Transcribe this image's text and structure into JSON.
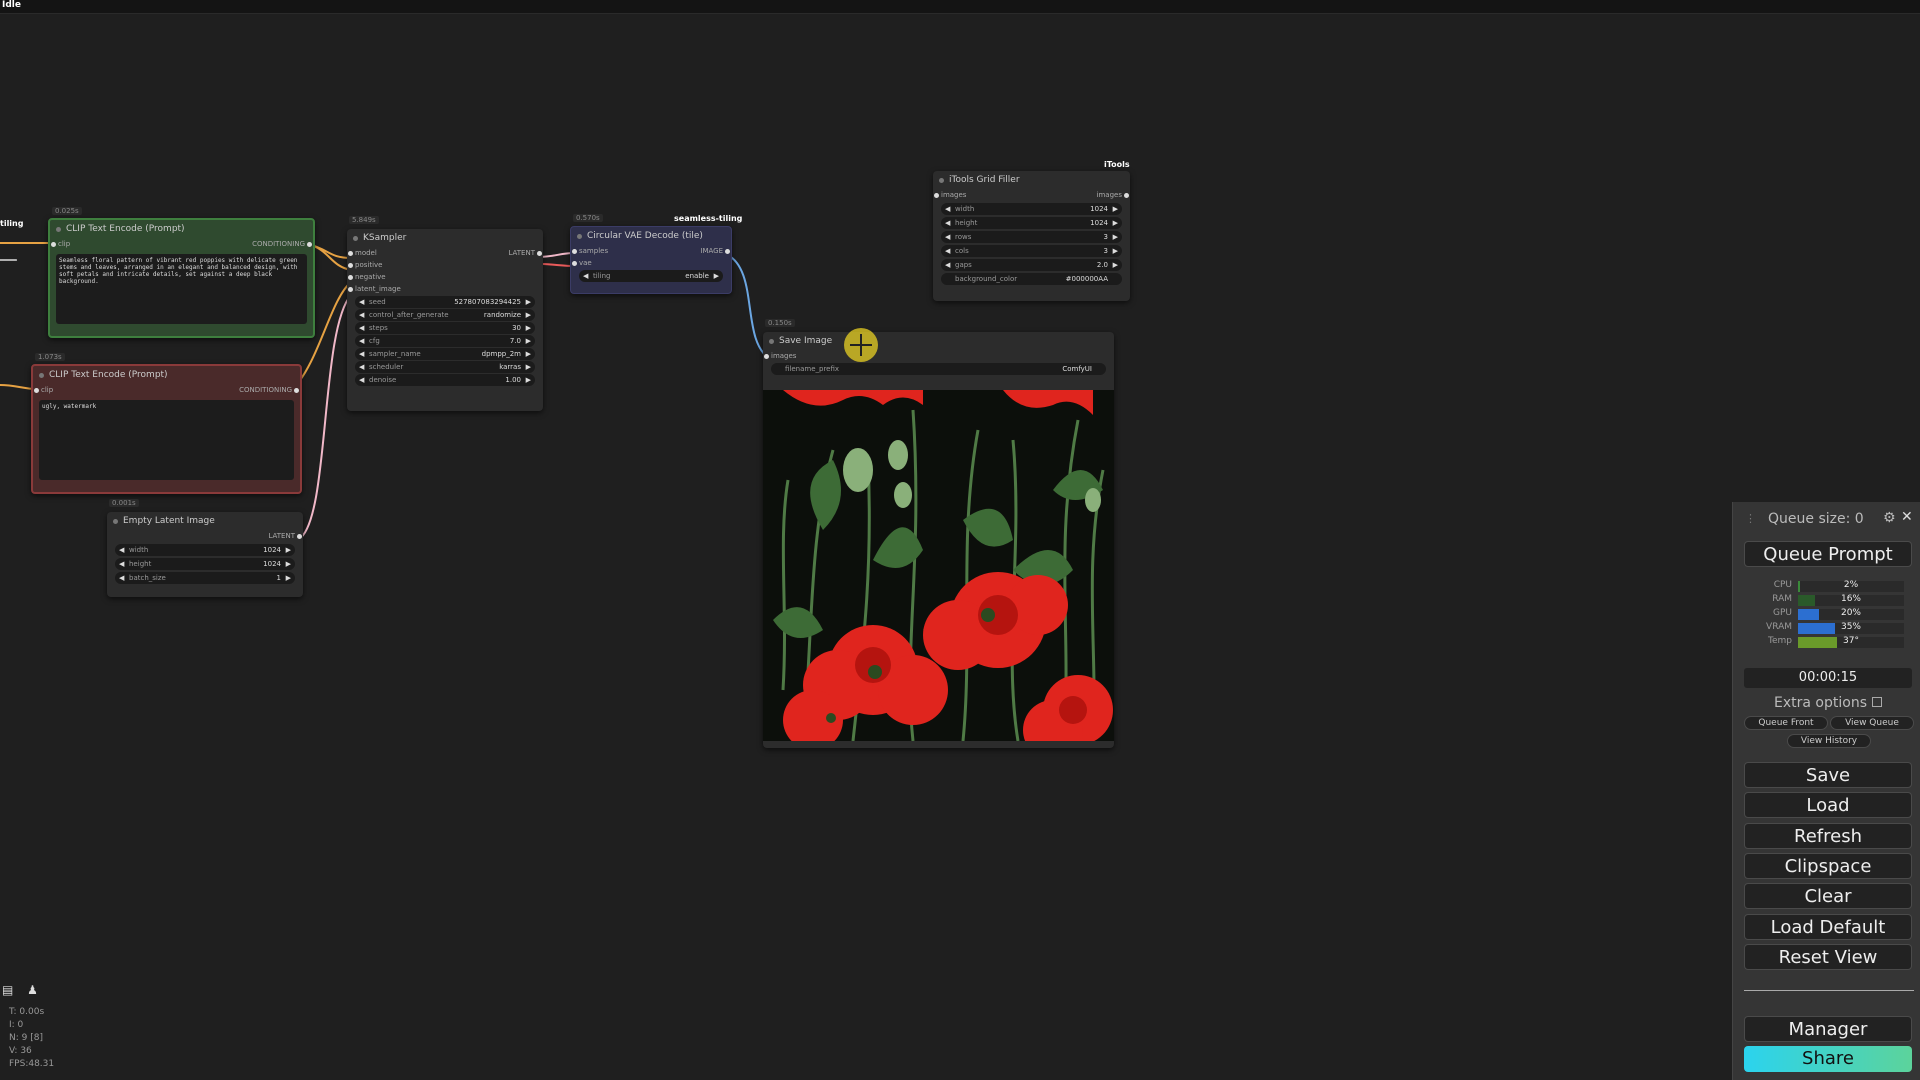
{
  "status": "Idle",
  "tags": {
    "itools": "iTools",
    "seamless": "seamless-tiling",
    "left_edge": "tiling"
  },
  "nodes": {
    "clip_pos": {
      "time": "0.025s",
      "title": "CLIP Text Encode (Prompt)",
      "input": "clip",
      "output": "CONDITIONING",
      "text": "Seamless floral pattern of vibrant red poppies with delicate green stems and leaves, arranged in an elegant and balanced design, with soft petals and intricate details, set against a deep black background."
    },
    "clip_neg": {
      "time": "1.073s",
      "title": "CLIP Text Encode (Prompt)",
      "input": "clip",
      "output": "CONDITIONING",
      "text": "ugly, watermark"
    },
    "empty_latent": {
      "time": "0.001s",
      "title": "Empty Latent Image",
      "output": "LATENT",
      "widgets": [
        {
          "label": "width",
          "value": "1024"
        },
        {
          "label": "height",
          "value": "1024"
        },
        {
          "label": "batch_size",
          "value": "1"
        }
      ]
    },
    "ksampler": {
      "time": "5.849s",
      "title": "KSampler",
      "inputs": [
        "model",
        "positive",
        "negative",
        "latent_image"
      ],
      "output": "LATENT",
      "widgets": [
        {
          "label": "seed",
          "value": "527807083294425"
        },
        {
          "label": "control_after_generate",
          "value": "randomize"
        },
        {
          "label": "steps",
          "value": "30"
        },
        {
          "label": "cfg",
          "value": "7.0"
        },
        {
          "label": "sampler_name",
          "value": "dpmpp_2m"
        },
        {
          "label": "scheduler",
          "value": "karras"
        },
        {
          "label": "denoise",
          "value": "1.00"
        }
      ]
    },
    "vae_decode": {
      "time": "0.570s",
      "title": "Circular VAE Decode (tile)",
      "inputs": [
        "samples",
        "vae"
      ],
      "output": "IMAGE",
      "widgets": [
        {
          "label": "tiling",
          "value": "enable"
        }
      ]
    },
    "grid_filler": {
      "title": "iTools Grid Filler",
      "input": "images",
      "output": "images",
      "widgets": [
        {
          "label": "width",
          "value": "1024"
        },
        {
          "label": "height",
          "value": "1024"
        },
        {
          "label": "rows",
          "value": "3"
        },
        {
          "label": "cols",
          "value": "3"
        },
        {
          "label": "gaps",
          "value": "2.0"
        },
        {
          "label": "background_color",
          "value": "#000000AA"
        }
      ]
    },
    "save_image": {
      "time": "0.150s",
      "title": "Save Image",
      "input": "images",
      "prefix_label": "filename_prefix",
      "prefix_value": "ComfyUI"
    }
  },
  "panel": {
    "queue_size": "Queue size: 0",
    "queue_prompt": "Queue Prompt",
    "stats": [
      {
        "label": "CPU",
        "value": "2%",
        "fraction": 0.02,
        "color": "#3a8a3a"
      },
      {
        "label": "RAM",
        "value": "16%",
        "fraction": 0.16,
        "color": "#2a5a2a"
      },
      {
        "label": "GPU",
        "value": "20%",
        "fraction": 0.2,
        "color": "#2c6fd1"
      },
      {
        "label": "VRAM",
        "value": "35%",
        "fraction": 0.35,
        "color": "#2c6fd1"
      },
      {
        "label": "Temp",
        "value": "37°",
        "fraction": 0.37,
        "color": "#6a9a2a"
      }
    ],
    "timer": "00:00:15",
    "extra_options": "Extra options",
    "queue_front": "Queue Front",
    "view_queue": "View Queue",
    "view_history": "View History",
    "buttons": [
      "Save",
      "Load",
      "Refresh",
      "Clipspace",
      "Clear",
      "Load Default",
      "Reset View"
    ],
    "manager": "Manager",
    "share": "Share"
  },
  "debug": [
    "T: 0.00s",
    "I: 0",
    "N: 9 [8]",
    "V: 36",
    "FPS:48.31"
  ],
  "icons": [
    "sidebar-toggle-icon",
    "bell-icon",
    "gear-icon",
    "close-icon",
    "plus-cursor-icon"
  ]
}
